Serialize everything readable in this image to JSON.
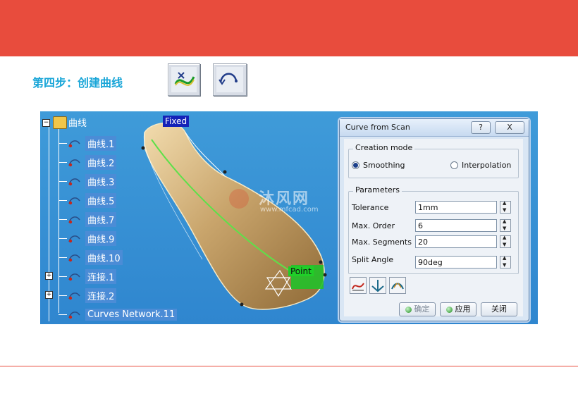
{
  "slide": {
    "step_title": "第四步：创建曲线",
    "colors": {
      "banner": "#e84c3d",
      "title": "#1aa6d8"
    }
  },
  "toolbar": {
    "buttons": [
      {
        "icon": "curve-from-scan-icon"
      },
      {
        "icon": "sketch-curve-icon"
      }
    ]
  },
  "tree": {
    "root_label": "曲线",
    "items": [
      {
        "label": "曲线.1",
        "icon": "curve-icon"
      },
      {
        "label": "曲线.2",
        "icon": "curve-icon"
      },
      {
        "label": "曲线.3",
        "icon": "curve-icon"
      },
      {
        "label": "曲线.5",
        "icon": "curve-icon"
      },
      {
        "label": "曲线.7",
        "icon": "curve-icon"
      },
      {
        "label": "曲线.9",
        "icon": "curve-icon"
      },
      {
        "label": "曲线.10",
        "icon": "curve-icon"
      },
      {
        "label": "连接.1",
        "icon": "join-icon"
      },
      {
        "label": "连接.2",
        "icon": "join-icon"
      },
      {
        "label": "Curves Network.11",
        "icon": "curves-network-icon"
      }
    ]
  },
  "viewport": {
    "fixed_label": "Fixed",
    "point_label": "Point",
    "watermark_cn": "沐风网",
    "watermark_url": "www.mfcad.com"
  },
  "dialog": {
    "title": "Curve from Scan",
    "help_label": "?",
    "close_label": "X",
    "creation_mode": {
      "title": "Creation mode",
      "options": [
        "Smoothing",
        "Interpolation"
      ],
      "selected": "Smoothing"
    },
    "parameters": {
      "title": "Parameters",
      "tolerance_label": "Tolerance",
      "tolerance_value": "1mm",
      "max_order_label": "Max. Order",
      "max_order_value": "6",
      "max_segments_label": "Max. Segments",
      "max_segments_value": "20",
      "split_angle_label": "Split Angle",
      "split_angle_value": "90deg"
    },
    "buttons": {
      "ok": "确定",
      "apply": "应用",
      "close": "关闭"
    }
  }
}
